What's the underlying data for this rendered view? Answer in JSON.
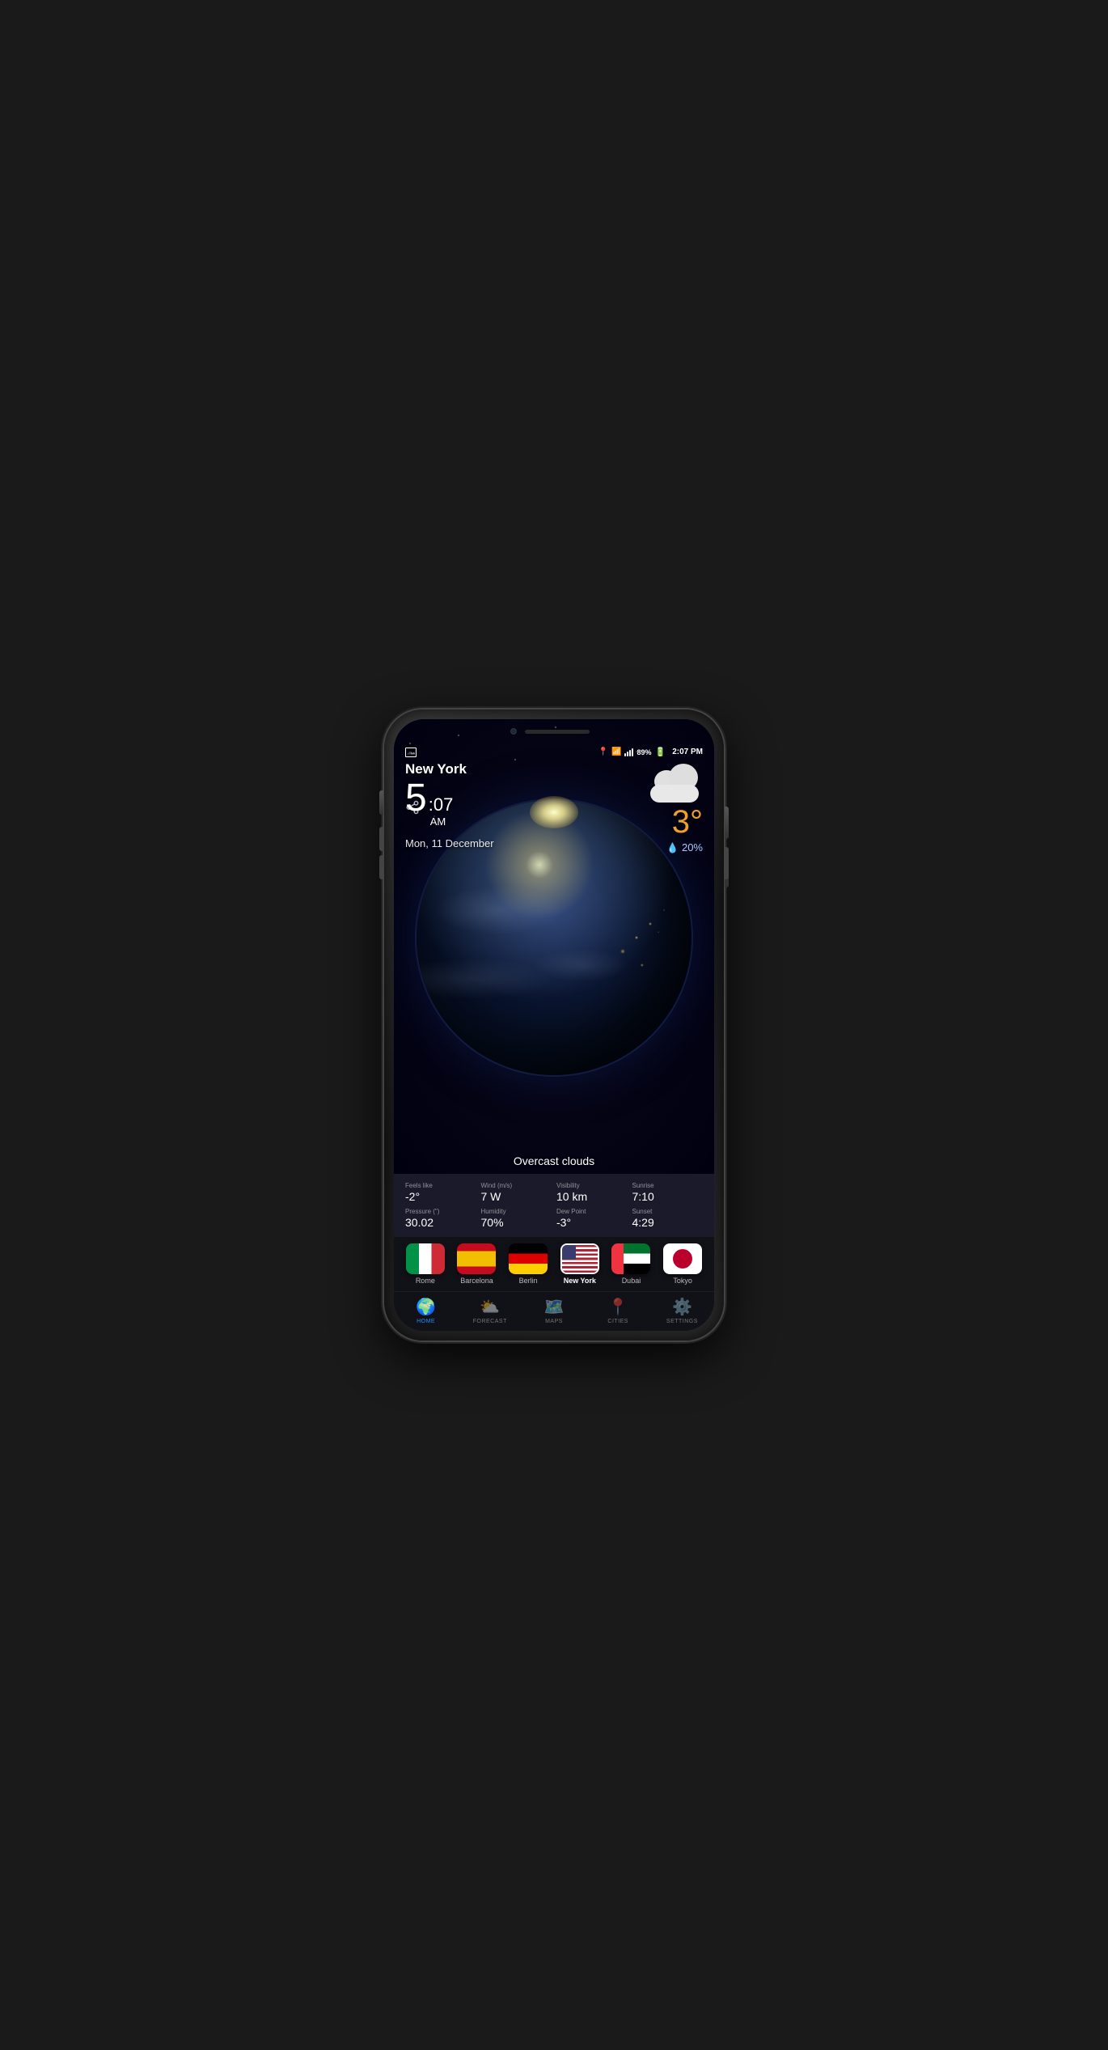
{
  "status_bar": {
    "time": "2:07 PM",
    "battery": "89%",
    "signal": "full"
  },
  "weather": {
    "city": "New York",
    "time_hour": "5",
    "time_min": "07",
    "time_ampm": "AM",
    "date": "Mon, 11 December",
    "temperature": "3°",
    "rain_chance": "20%",
    "condition": "Overcast clouds",
    "stats": [
      {
        "label": "Feels like",
        "value": "-2°"
      },
      {
        "label": "Wind (m/s)",
        "value": "7 W"
      },
      {
        "label": "Visibility",
        "value": "10 km"
      },
      {
        "label": "Sunrise",
        "value": "7:10"
      },
      {
        "label": "Pressure (\")",
        "value": "30.02"
      },
      {
        "label": "Humidity",
        "value": "70%"
      },
      {
        "label": "Dew Point",
        "value": "-3°"
      },
      {
        "label": "Sunset",
        "value": "4:29"
      }
    ]
  },
  "cities": [
    {
      "name": "Rome",
      "flag": "italy",
      "selected": false
    },
    {
      "name": "Barcelona",
      "flag": "spain",
      "selected": false
    },
    {
      "name": "Berlin",
      "flag": "germany",
      "selected": false
    },
    {
      "name": "New York",
      "flag": "usa",
      "selected": true
    },
    {
      "name": "Dubai",
      "flag": "uae",
      "selected": false
    },
    {
      "name": "Tokyo",
      "flag": "japan",
      "selected": false
    }
  ],
  "nav": [
    {
      "id": "home",
      "label": "HOME",
      "active": true
    },
    {
      "id": "forecast",
      "label": "FORECAST",
      "active": false
    },
    {
      "id": "maps",
      "label": "MAPS",
      "active": false
    },
    {
      "id": "cities",
      "label": "CITIES",
      "active": false
    },
    {
      "id": "settings",
      "label": "SETTINGS",
      "active": false
    }
  ]
}
